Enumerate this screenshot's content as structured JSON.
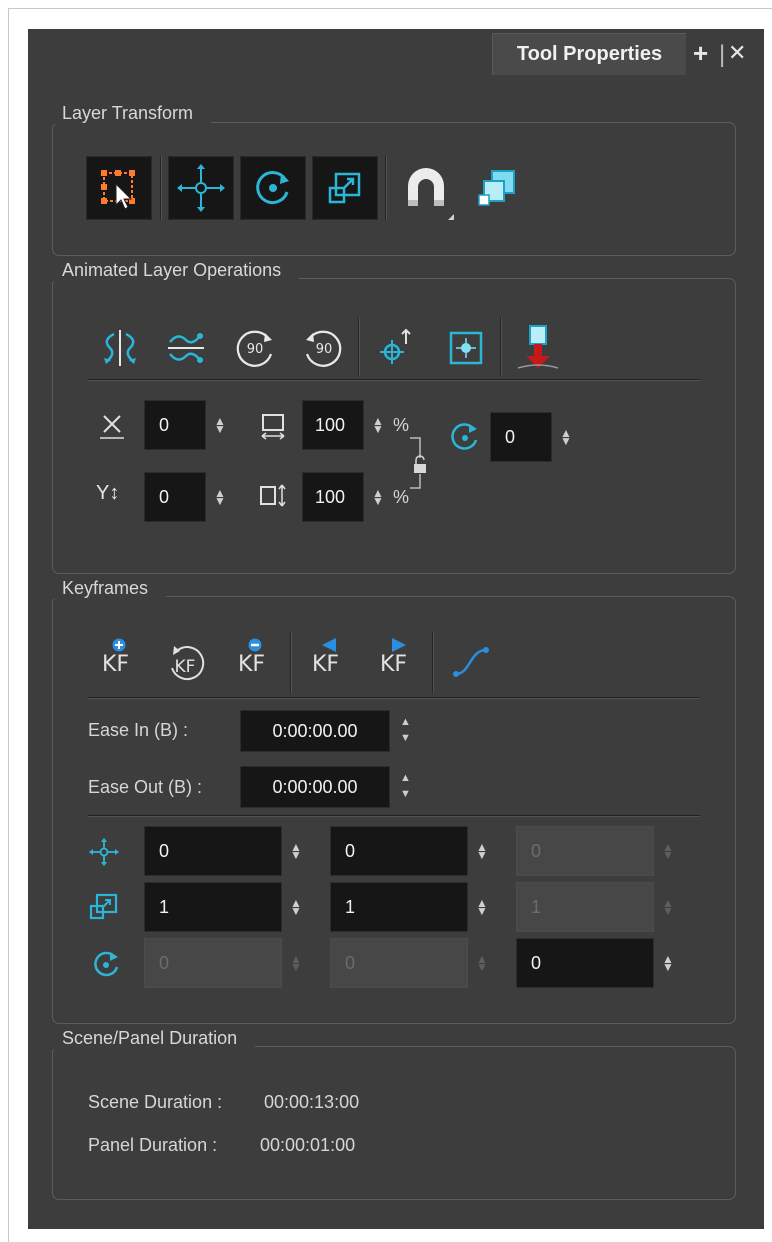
{
  "panel": {
    "tab_title": "Tool Properties",
    "tab_add": "+",
    "tab_divider": "|",
    "tab_close": "✕"
  },
  "layer_transform": {
    "title": "Layer Transform",
    "tools": [
      "transform-selection",
      "translate",
      "rotate",
      "scale",
      "snap-magnet",
      "layer-bounding-box"
    ]
  },
  "animated_ops": {
    "title": "Animated Layer Operations",
    "icons": [
      "flip-horizontal",
      "flip-vertical",
      "rotate-90-cw",
      "rotate-90-ccw",
      "center-on-pivot",
      "reset-transform",
      "bake-down"
    ],
    "rotate_cw_label": "90",
    "rotate_ccw_label": "90",
    "x_value": "0",
    "y_value": "0",
    "width_value": "100",
    "height_value": "100",
    "width_unit": "%",
    "height_unit": "%",
    "angle_value": "0"
  },
  "keyframes": {
    "title": "Keyframes",
    "kf_label": "KF",
    "ease_in_label": "Ease In (B) :",
    "ease_in_value": "0:00:00.00",
    "ease_out_label": "Ease Out (B) :",
    "ease_out_value": "0:00:00.00",
    "rows": [
      {
        "icon": "translate-icon",
        "values": [
          "0",
          "0",
          "0"
        ],
        "enabled": [
          true,
          true,
          false
        ]
      },
      {
        "icon": "scale-icon",
        "values": [
          "1",
          "1",
          "1"
        ],
        "enabled": [
          true,
          true,
          false
        ]
      },
      {
        "icon": "rotate-icon",
        "values": [
          "0",
          "0",
          "0"
        ],
        "enabled": [
          false,
          false,
          true
        ]
      }
    ]
  },
  "duration": {
    "title": "Scene/Panel Duration",
    "scene_label": "Scene Duration :",
    "scene_value": "00:00:13:00",
    "panel_label": "Panel Duration :",
    "panel_value": "00:00:01:00"
  },
  "colors": {
    "panel_bg": "#3d3d3d",
    "accent_cyan": "#2bb6d8",
    "accent_blue": "#2a8fe0",
    "field_bg": "#161616"
  }
}
